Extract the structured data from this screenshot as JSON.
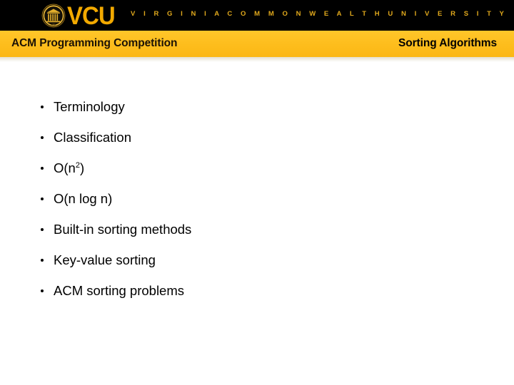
{
  "header": {
    "logo_word": "VCU",
    "seal_name": "vcu-seal",
    "tagline": "V I R G I N I A   C O M M O N W E A L T H   U N I V E R S I T Y",
    "background_color": "#000000",
    "logo_color": "#F2A900"
  },
  "banner": {
    "left_title": "ACM Programming Competition",
    "right_title": "Sorting Algorithms",
    "background_color": "#FDBD1C",
    "text_color": "#000000"
  },
  "content": {
    "bullets": [
      {
        "label": "Terminology"
      },
      {
        "label": "Classification"
      },
      {
        "label": "O(n",
        "sup": "2",
        "label_after": ")"
      },
      {
        "label": "O(n log n)"
      },
      {
        "label": "Built-in sorting methods"
      },
      {
        "label": "Key-value sorting"
      },
      {
        "label": "ACM sorting problems"
      }
    ]
  },
  "page": {
    "background_color": "#FFFFFF"
  }
}
